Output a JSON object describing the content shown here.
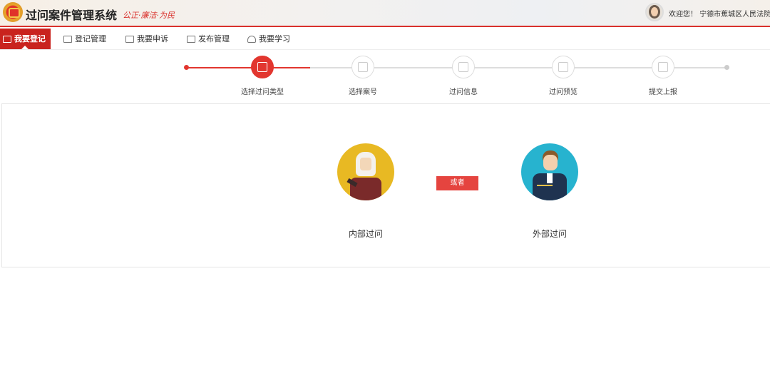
{
  "header": {
    "title": "过问案件管理系统",
    "slogan": "公正·廉洁·为民",
    "welcome": "欢迎您！ 宁德市蕉城区人民法院 <"
  },
  "nav": {
    "items": [
      {
        "label": "我要登记",
        "active": true
      },
      {
        "label": "登记管理"
      },
      {
        "label": "我要申诉"
      },
      {
        "label": "发布管理"
      },
      {
        "label": "我要学习"
      }
    ]
  },
  "steps": {
    "items": [
      {
        "label": "选择过问类型",
        "active": true
      },
      {
        "label": "选择案号"
      },
      {
        "label": "过问信息"
      },
      {
        "label": "过问预览"
      },
      {
        "label": "提交上报"
      }
    ]
  },
  "choices": {
    "internal": "内部过问",
    "or": "或者",
    "external": "外部过问"
  },
  "colors": {
    "accent": "#c9231e",
    "step_active": "#e2362f",
    "internal_bg": "#e8b923",
    "external_bg": "#27b3cf"
  }
}
